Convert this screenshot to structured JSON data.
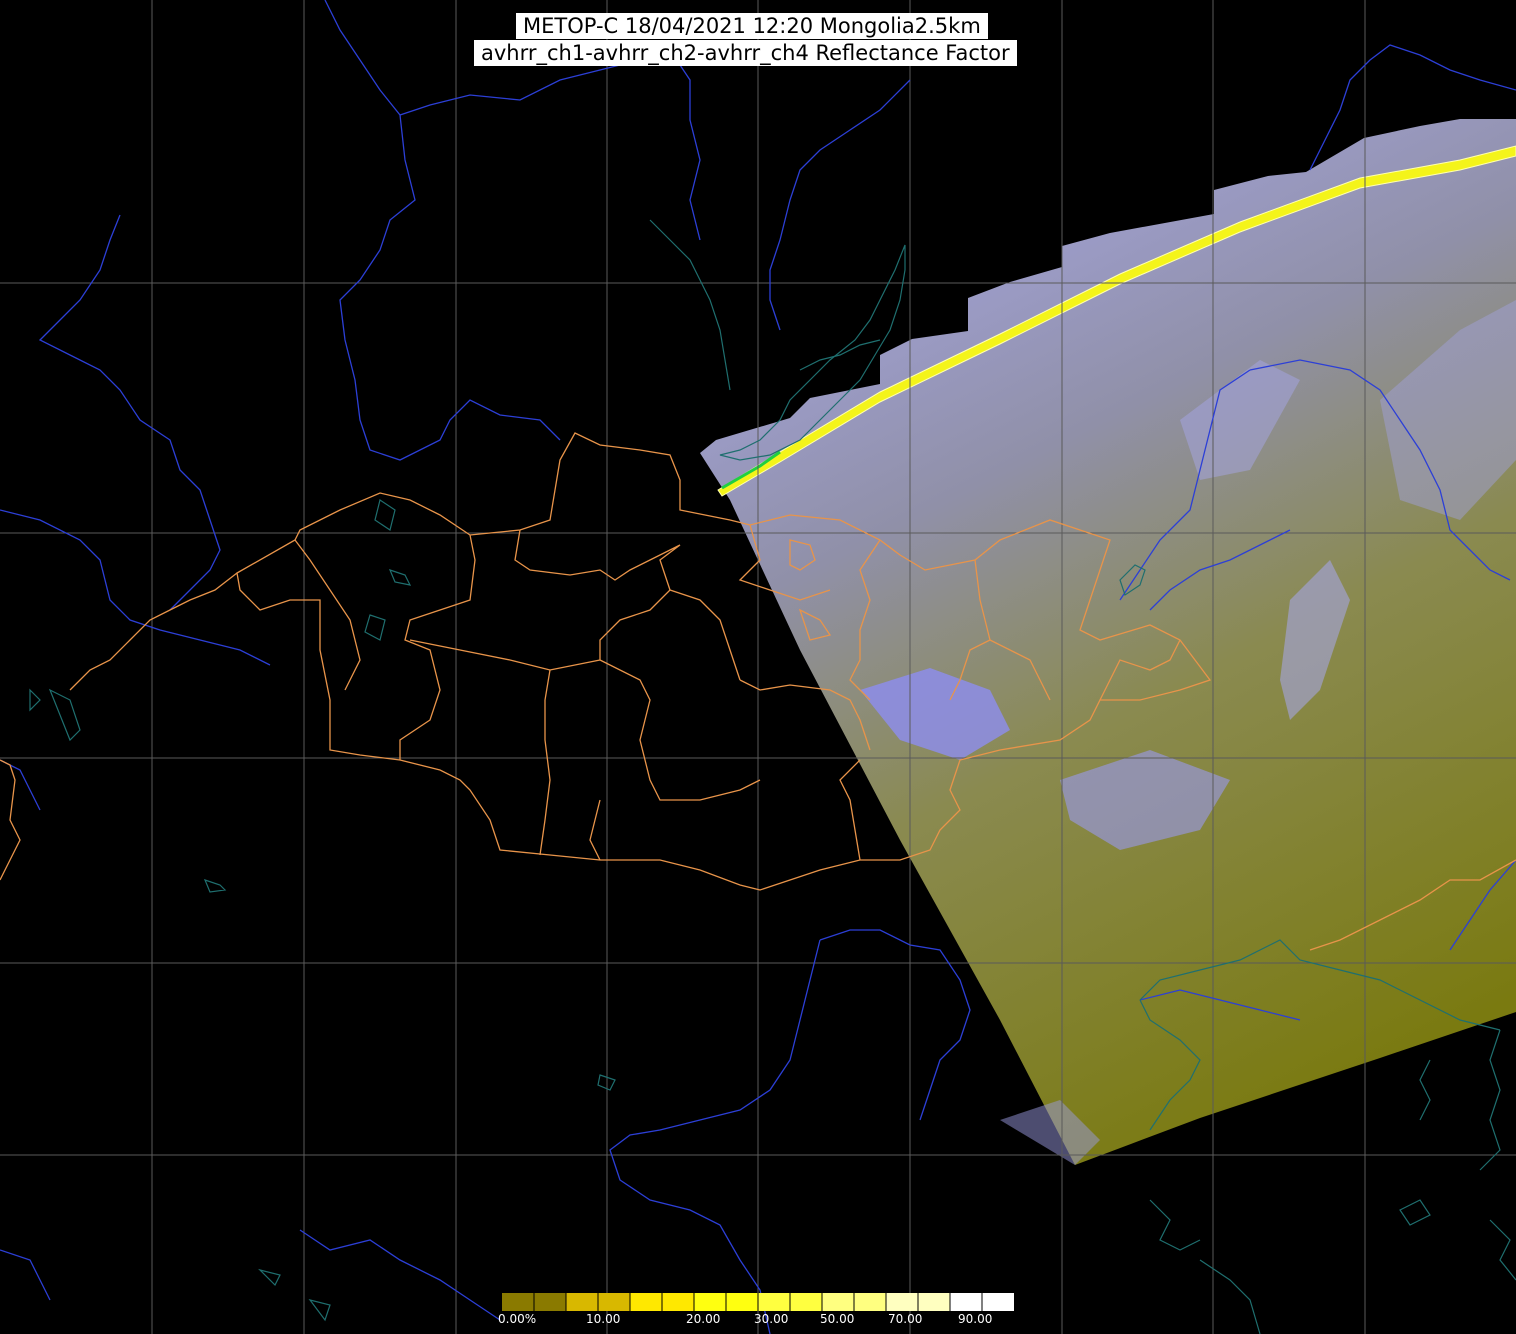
{
  "header": {
    "title_line1": "METOP-C 18/04/2021 12:20 Mongolia2.5km",
    "title_line2": "avhrr_ch1-avhrr_ch2-avhrr_ch4 Reflectance Factor"
  },
  "colorbar": {
    "labels": [
      "0.00%",
      "10.00",
      "20.00",
      "30.00",
      "50.00",
      "70.00",
      "90.00"
    ],
    "colors": [
      "#6b6b00",
      "#b59a00",
      "#ffe000",
      "#ffff00",
      "#ffff40",
      "#ffff90",
      "#ffffd0",
      "#ffffff"
    ]
  },
  "colors": {
    "background": "#000000",
    "graticule": "#5a5a5a",
    "rivers_coast": "#2c3fd6",
    "lakes": "#1f6f6f",
    "admin_borders": "#e8944a",
    "swath_cloud": "#8c8cff",
    "swath_ground": "#7a7a10"
  }
}
